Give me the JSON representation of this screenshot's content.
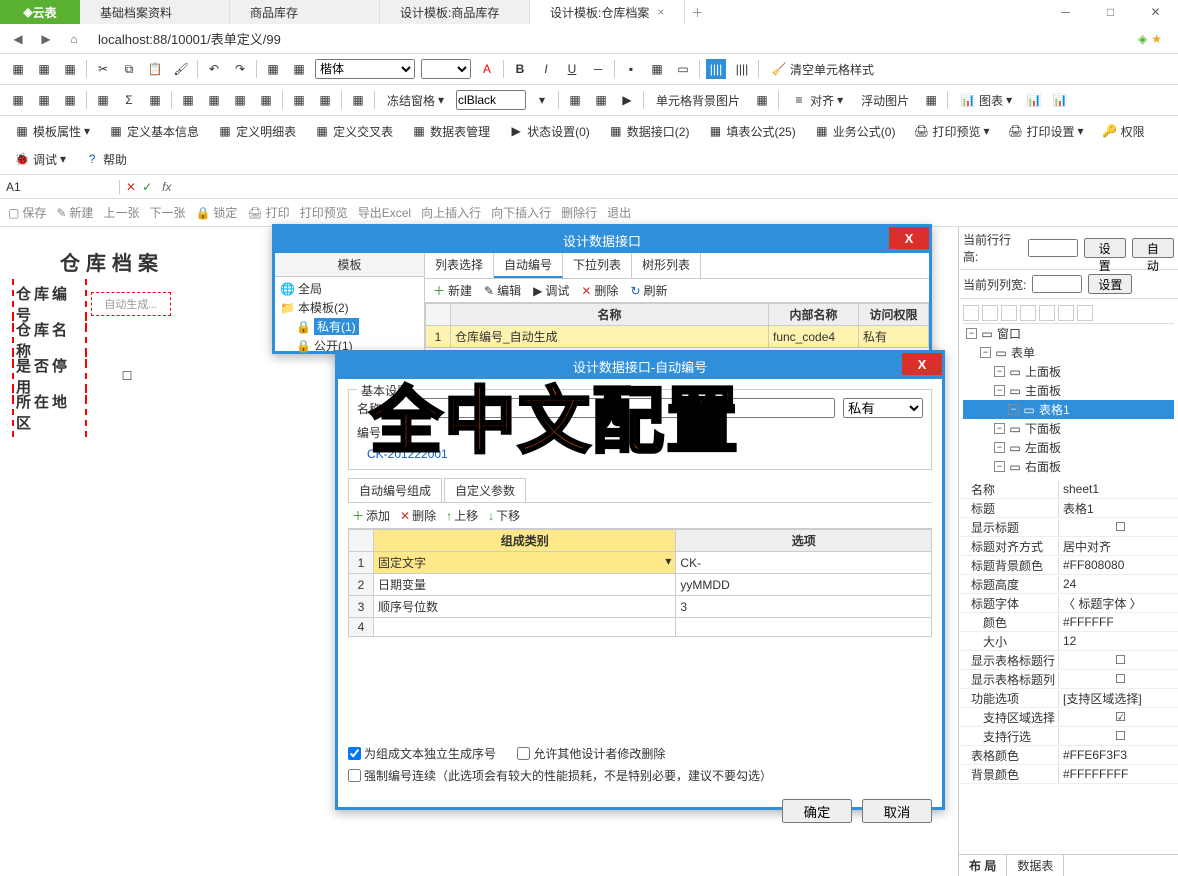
{
  "app": {
    "name": "云表"
  },
  "tabs": [
    {
      "label": "基础档案资料"
    },
    {
      "label": "商品库存"
    },
    {
      "label": "设计模板:商品库存"
    },
    {
      "label": "设计模板:仓库档案",
      "active": true
    }
  ],
  "url": "localhost:88/10001/表单定义/99",
  "toolbar2": {
    "font_combo": "楷体",
    "color_combo": "clBlack",
    "freeze": "冻结窗格",
    "bgimg": "单元格背景图片",
    "align": "对齐",
    "floatimg": "浮动图片",
    "chart": "图表",
    "clear_style": "清空单元格样式"
  },
  "toolbar3": {
    "tmpl_prop": "模板属性",
    "def_basic": "定义基本信息",
    "def_detail": "定义明细表",
    "def_cross": "定义交叉表",
    "data_table": "数据表管理",
    "status": "状态设置(0)",
    "data_api": "数据接口(2)",
    "fill_formula": "填表公式(25)",
    "biz_formula": "业务公式(0)",
    "print_preview": "打印预览",
    "print_setting": "打印设置",
    "perm": "权限",
    "debug": "调试",
    "help": "帮助"
  },
  "formula": {
    "cell": "A1",
    "fx": "fx"
  },
  "actions": {
    "save": "保存",
    "new": "新建",
    "prev": "上一张",
    "next": "下一张",
    "lock": "锁定",
    "print": "打印",
    "preview": "打印预览",
    "export": "导出Excel",
    "insert_up": "向上插入行",
    "insert_down": "向下插入行",
    "del_row": "删除行",
    "exit": "退出"
  },
  "sheet": {
    "title": "仓库档案",
    "rows": [
      {
        "label": "仓库编号",
        "value": "自动生成..."
      },
      {
        "label": "仓库名称",
        "value": ""
      },
      {
        "label": "是否停用",
        "value": "☐"
      },
      {
        "label": "所在地区",
        "value": ""
      }
    ]
  },
  "right_panel": {
    "row_h_label": "当前行行高:",
    "row_h_btn": "设置",
    "auto_btn": "自动",
    "col_w_label": "当前列列宽:",
    "col_w_btn": "设置",
    "tree": [
      {
        "label": "窗口",
        "depth": 0
      },
      {
        "label": "表单",
        "depth": 1
      },
      {
        "label": "上面板",
        "depth": 2
      },
      {
        "label": "主面板",
        "depth": 2
      },
      {
        "label": "表格1",
        "depth": 3,
        "selected": true
      },
      {
        "label": "下面板",
        "depth": 2
      },
      {
        "label": "左面板",
        "depth": 2
      },
      {
        "label": "右面板",
        "depth": 2
      }
    ],
    "props": [
      {
        "k": "名称",
        "v": "sheet1"
      },
      {
        "k": "标题",
        "v": "表格1"
      },
      {
        "k": "显示标题",
        "v": "☐"
      },
      {
        "k": "标题对齐方式",
        "v": "居中对齐"
      },
      {
        "k": "标题背景颜色",
        "v": "#FF808080"
      },
      {
        "k": "标题高度",
        "v": "24"
      },
      {
        "k": "标题字体",
        "v": "〈 标题字体 〉"
      },
      {
        "k": "颜色",
        "v": "#FFFFFF",
        "indent": true
      },
      {
        "k": "大小",
        "v": "12",
        "indent": true
      },
      {
        "k": "显示表格标题行",
        "v": "☐"
      },
      {
        "k": "显示表格标题列",
        "v": "☐"
      },
      {
        "k": "功能选项",
        "v": "[支持区域选择]"
      },
      {
        "k": "支持区域选择",
        "v": "☑",
        "indent": true
      },
      {
        "k": "支持行选",
        "v": "☐",
        "indent": true
      },
      {
        "k": "表格颜色",
        "v": "#FFE6F3F3"
      },
      {
        "k": "背景颜色",
        "v": "#FFFFFFFF"
      }
    ],
    "footer_tabs": [
      "布 局",
      "数据表"
    ]
  },
  "dlg1": {
    "title": "设计数据接口",
    "left_title": "模板",
    "tree": [
      {
        "label": "全局",
        "icon": "globe"
      },
      {
        "label": "本模板(2)",
        "icon": "folder"
      },
      {
        "label": "私有(1)",
        "icon": "lock",
        "selected": true,
        "indent": 1
      },
      {
        "label": "公开(1)",
        "icon": "lock",
        "indent": 1
      }
    ],
    "tabs": [
      "列表选择",
      "自动编号",
      "下拉列表",
      "树形列表"
    ],
    "active_tab": 1,
    "toolbar": [
      {
        "icon": "＋",
        "cls": "green",
        "label": "新建"
      },
      {
        "icon": "✎",
        "cls": "",
        "label": "编辑"
      },
      {
        "icon": "▶",
        "cls": "",
        "label": "调试"
      },
      {
        "icon": "✕",
        "cls": "red",
        "label": "删除"
      },
      {
        "icon": "↻",
        "cls": "blue",
        "label": "刷新"
      }
    ],
    "table": {
      "headers": [
        "名称",
        "内部名称",
        "访问权限"
      ],
      "rows": [
        {
          "n": "1",
          "name": "仓库编号_自动生成",
          "internal": "func_code4",
          "perm": "私有"
        }
      ]
    }
  },
  "dlg2": {
    "title": "设计数据接口-自动编号",
    "group1_title": "基本设置",
    "name_label": "名称:",
    "num_label": "编号",
    "perm_value": "私有",
    "preview": "CK-201222001",
    "inner_tabs": [
      "自动编号组成",
      "自定义参数"
    ],
    "inner_toolbar": [
      {
        "icon": "＋",
        "cls": "green",
        "label": "添加"
      },
      {
        "icon": "✕",
        "cls": "red",
        "label": "删除"
      },
      {
        "icon": "↑",
        "cls": "green",
        "label": "上移"
      },
      {
        "icon": "↓",
        "cls": "green",
        "label": "下移"
      }
    ],
    "table": {
      "headers": [
        "组成类别",
        "选项"
      ],
      "rows": [
        {
          "n": "1",
          "cat": "固定文字",
          "opt": "CK-",
          "sel": true
        },
        {
          "n": "2",
          "cat": "日期变量",
          "opt": "yyMMDD"
        },
        {
          "n": "3",
          "cat": "顺序号位数",
          "opt": "3"
        },
        {
          "n": "4",
          "cat": "",
          "opt": ""
        }
      ]
    },
    "check1": "为组成文本独立生成序号",
    "check2": "允许其他设计者修改删除",
    "check3": "强制编号连续（此选项会有较大的性能损耗，不是特别必要，建议不要勾选）",
    "ok": "确定",
    "cancel": "取消"
  },
  "overlay": "全中文配置"
}
